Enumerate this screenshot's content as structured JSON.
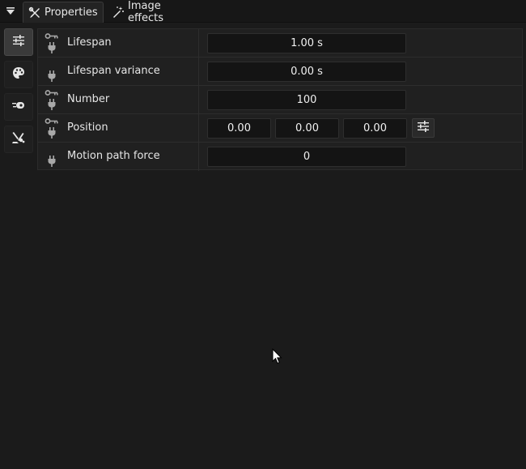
{
  "tabs": [
    {
      "label": "Properties",
      "icon": "tools-icon",
      "active": true
    },
    {
      "label": "Image effects",
      "icon": "magic-wand-icon",
      "active": false
    }
  ],
  "sidebar": {
    "items": [
      {
        "icon": "sliders-icon",
        "active": true
      },
      {
        "icon": "palette-icon",
        "active": false
      },
      {
        "icon": "behaviors-icon",
        "active": false
      },
      {
        "icon": "effects-icon",
        "active": false
      }
    ]
  },
  "properties": [
    {
      "label": "Lifespan",
      "value": "1.00 s",
      "has_key": true
    },
    {
      "label": "Lifespan variance",
      "value": "0.00 s",
      "has_key": false
    },
    {
      "label": "Number",
      "value": "100",
      "has_key": true
    },
    {
      "label": "Position",
      "values": [
        "0.00",
        "0.00",
        "0.00"
      ],
      "has_key": true
    },
    {
      "label": "Motion path force",
      "value": "0",
      "has_key": false
    }
  ],
  "colors": {
    "background": "#1b1b1b",
    "panel": "#202020",
    "field": "#141414",
    "text": "#e6e6e6"
  }
}
